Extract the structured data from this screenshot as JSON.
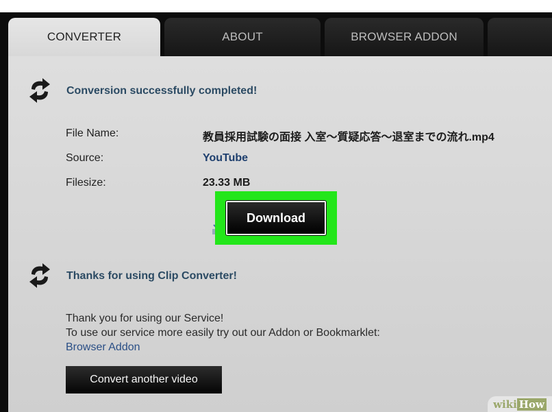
{
  "tabs": [
    {
      "label": "CONVERTER",
      "active": true
    },
    {
      "label": "ABOUT",
      "active": false
    },
    {
      "label": "BROWSER ADDON",
      "active": false
    },
    {
      "label": "",
      "active": false
    }
  ],
  "result": {
    "heading": "Conversion successfully completed!",
    "rows": [
      {
        "label": "File Name:",
        "value": "教員採用試験の面接 入室〜質疑応答〜退室までの流れ.mp4"
      },
      {
        "label": "Source:",
        "value": "YouTube"
      },
      {
        "label": "Filesize:",
        "value": "23.33 MB"
      }
    ],
    "download_label": "Download",
    "highlight_color": "#23e61a"
  },
  "thanks": {
    "heading": "Thanks for using Clip Converter!",
    "line1": "Thank you for using our Service!",
    "line2": "To use our service more easily try out our Addon or Bookmarklet:",
    "addon_link": "Browser Addon",
    "convert_button": "Convert another video"
  },
  "watermark": {
    "part1": "wiki",
    "part2": "How"
  },
  "icons": {
    "sync": "sync-arrows-icon",
    "download": "download-icon"
  }
}
